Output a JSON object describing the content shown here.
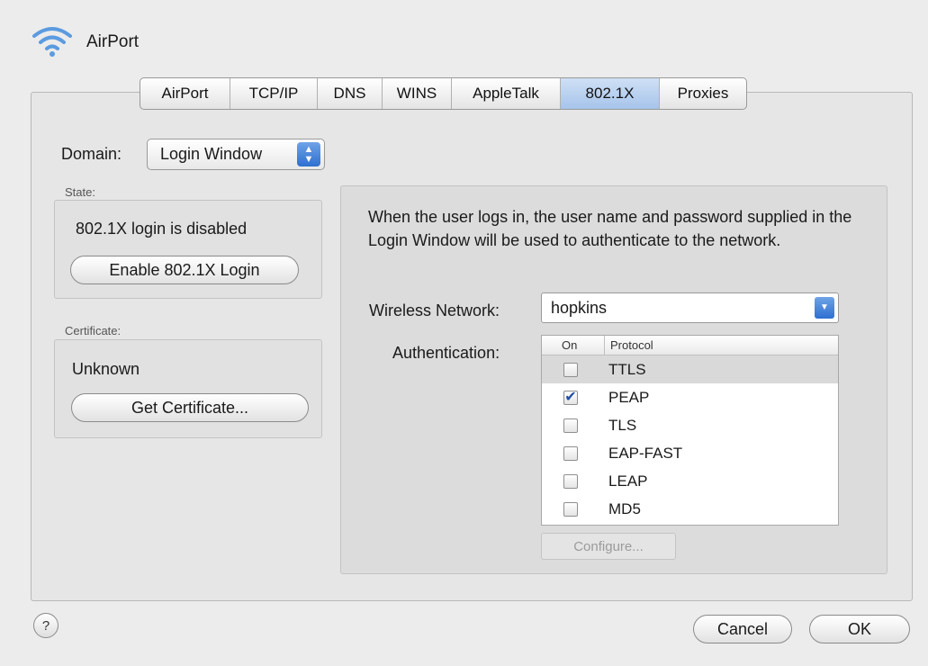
{
  "window": {
    "title": "AirPort",
    "icon": "wifi-icon"
  },
  "tabs": [
    {
      "label": "AirPort",
      "active": false
    },
    {
      "label": "TCP/IP",
      "active": false
    },
    {
      "label": "DNS",
      "active": false
    },
    {
      "label": "WINS",
      "active": false
    },
    {
      "label": "AppleTalk",
      "active": false
    },
    {
      "label": "802.1X",
      "active": true
    },
    {
      "label": "Proxies",
      "active": false
    }
  ],
  "domain": {
    "label": "Domain:",
    "value": "Login Window"
  },
  "state": {
    "label": "State:",
    "status": "802.1X login is disabled",
    "button": "Enable 802.1X Login"
  },
  "certificate": {
    "label": "Certificate:",
    "status": "Unknown",
    "button": "Get Certificate..."
  },
  "description": "When the user logs in, the user name and password supplied in the Login Window will be used to authenticate to the network.",
  "wireless_network": {
    "label": "Wireless Network:",
    "value": "hopkins"
  },
  "authentication": {
    "label": "Authentication:",
    "columns": {
      "on": "On",
      "protocol": "Protocol"
    },
    "rows": [
      {
        "protocol": "TTLS",
        "checked": false,
        "selected": true
      },
      {
        "protocol": "PEAP",
        "checked": true,
        "selected": false
      },
      {
        "protocol": "TLS",
        "checked": false,
        "selected": false
      },
      {
        "protocol": "EAP-FAST",
        "checked": false,
        "selected": false
      },
      {
        "protocol": "LEAP",
        "checked": false,
        "selected": false
      },
      {
        "protocol": "MD5",
        "checked": false,
        "selected": false
      }
    ],
    "configure_button": "Configure..."
  },
  "footer": {
    "help": "?",
    "cancel": "Cancel",
    "ok": "OK"
  },
  "colors": {
    "accent": "#2e6fd0",
    "tab_active": "#a6c4ea",
    "check": "#1f4fa8"
  }
}
